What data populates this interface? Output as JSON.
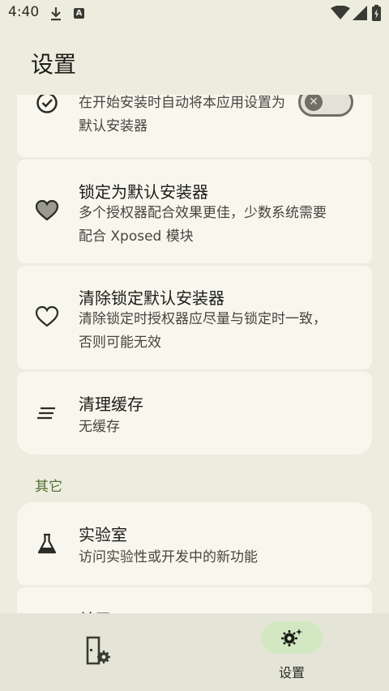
{
  "status_bar": {
    "time": "4:40",
    "notif_a": "A"
  },
  "page_title": "设置",
  "items": [
    {
      "title": "",
      "subtitle": "在开始安装时自动将本应用设置为默认安装器",
      "icon": "check-circle-icon",
      "toggle": "off"
    },
    {
      "title": "锁定为默认安装器",
      "subtitle": "多个授权器配合效果更佳，少数系统需要配合 Xposed 模块",
      "icon": "heart-filled-icon"
    },
    {
      "title": "清除锁定默认安装器",
      "subtitle": "清除锁定时授权器应尽量与锁定时一致，否则可能无效",
      "icon": "heart-outline-icon"
    },
    {
      "title": "清理缓存",
      "subtitle": "无缓存",
      "icon": "clear-cache-icon"
    }
  ],
  "section_other": "其它",
  "lab": {
    "title": "实验室",
    "subtitle": "访问实验性或开发中的新功能",
    "icon": "flask-icon"
  },
  "next_item_partial": "关于",
  "nav": {
    "settings_label": "设置"
  },
  "colors": {
    "background": "#ededdf",
    "card": "#f8f7ee",
    "section": "#566e36",
    "nav_pill": "#d3e8c2"
  }
}
